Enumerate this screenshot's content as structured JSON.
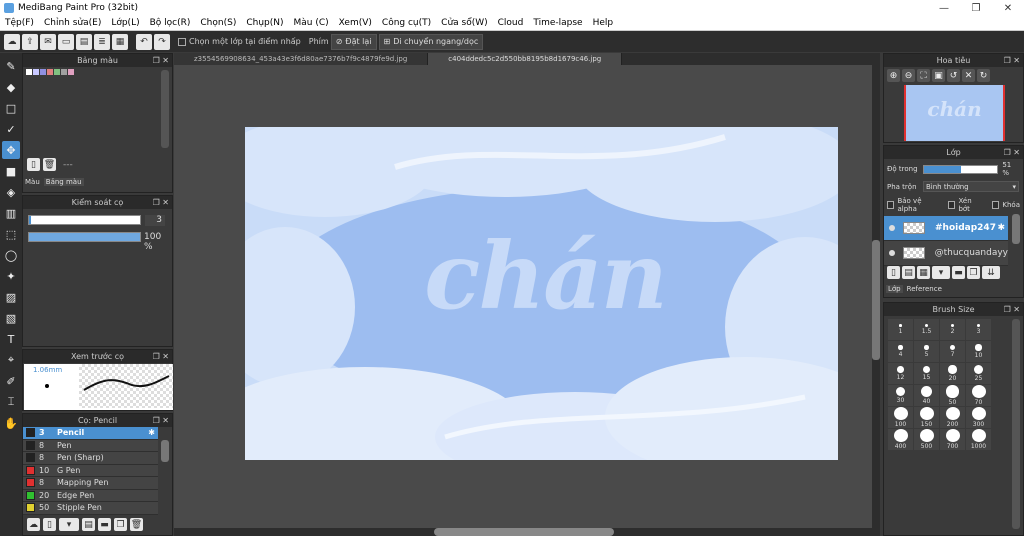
{
  "window": {
    "title": "MediBang Paint Pro (32bit)",
    "minimize": "—",
    "restore": "❐",
    "close": "✕"
  },
  "menu": [
    "Tệp(F)",
    "Chỉnh sửa(E)",
    "Lớp(L)",
    "Bộ lọc(R)",
    "Chọn(S)",
    "Chụp(N)",
    "Màu (C)",
    "Xem(V)",
    "Công cụ(T)",
    "Cửa sổ(W)",
    "Cloud",
    "Time-lapse",
    "Help"
  ],
  "toolbar": {
    "select_layer_label": "Chọn một lớp tại điểm nhấp",
    "key_label": "Phím",
    "reset_label": "Đặt lại",
    "move_label": "Di chuyển ngang/dọc"
  },
  "tabs": [
    "z3554569908634_453a43e3f6d80ae7376b7f9c4879fe9d.jpg",
    "c404ddedc5c2d550bb8195b8d1679c46.jpg"
  ],
  "palette": {
    "title": "Bảng màu",
    "ellipsis": "---",
    "tab_color": "Màu",
    "tab_palette": "Bảng màu",
    "swatches": [
      "#ffffff",
      "#c8c8ff",
      "#9090e0",
      "#e08080",
      "#80c080",
      "#a0a0a0",
      "#e0a0c0"
    ]
  },
  "brush_control": {
    "title": "Kiểm soát cọ",
    "size": "3",
    "opacity": "100 %",
    "opacity_fraction": 1.0
  },
  "preview": {
    "title": "Xem trước cọ",
    "size": "1.06mm"
  },
  "brushes": {
    "title": "Cọ: Pencil",
    "items": [
      {
        "size": "3",
        "name": "Pencil",
        "color": "#222222",
        "selected": true
      },
      {
        "size": "8",
        "name": "Pen",
        "color": "#222222"
      },
      {
        "size": "8",
        "name": "Pen (Sharp)",
        "color": "#222222"
      },
      {
        "size": "10",
        "name": "G Pen",
        "color": "#e03030"
      },
      {
        "size": "8",
        "name": "Mapping Pen",
        "color": "#e03030"
      },
      {
        "size": "20",
        "name": "Edge Pen",
        "color": "#30c030"
      },
      {
        "size": "50",
        "name": "Stipple Pen",
        "color": "#e0d030"
      }
    ]
  },
  "canvas": {
    "text": "chán",
    "bg": "#a9c6f2"
  },
  "navigator": {
    "title": "Hoa tiêu"
  },
  "layers": {
    "title": "Lớp",
    "opacity_label": "Độ trong",
    "opacity": "51 %",
    "opacity_fraction": 0.51,
    "blend_label": "Pha trộn",
    "blend": "Bình thường",
    "protect_alpha": "Bảo vệ alpha",
    "clip": "Xén bớt",
    "lock": "Khóa",
    "items": [
      {
        "name": "#hoidap247",
        "selected": true
      },
      {
        "name": "@thucquandayy"
      }
    ],
    "tab_layer": "Lớp",
    "tab_reference": "Reference"
  },
  "brush_size": {
    "title": "Brush Size",
    "sizes": [
      "1",
      "1.5",
      "2",
      "3",
      "4",
      "5",
      "7",
      "10",
      "12",
      "15",
      "20",
      "25",
      "30",
      "40",
      "50",
      "70",
      "100",
      "150",
      "200",
      "300",
      "400",
      "500",
      "700",
      "1000"
    ]
  }
}
